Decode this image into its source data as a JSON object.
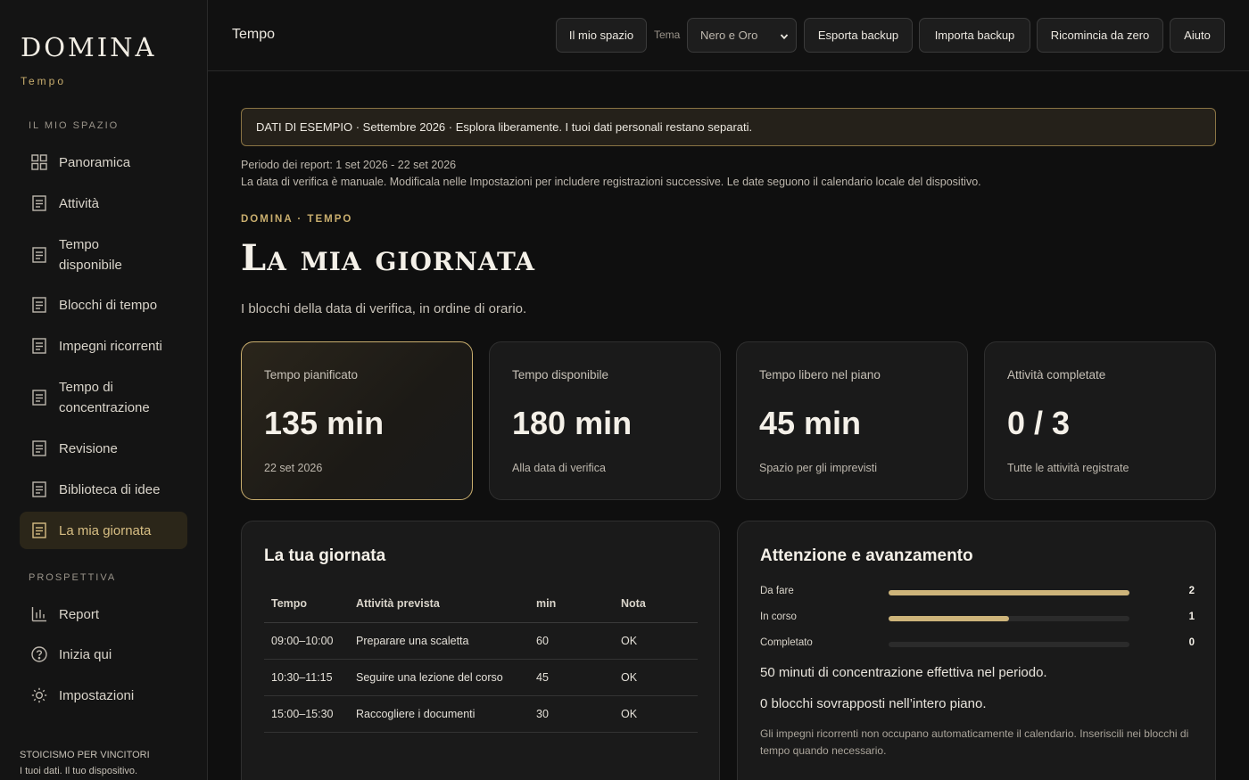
{
  "sidebar": {
    "brand": "DOMINA",
    "brand_sub": "Tempo",
    "section1": "IL MIO SPAZIO",
    "items": [
      {
        "label": "Panoramica",
        "icon": "grid-icon"
      },
      {
        "label": "Attività",
        "icon": "document-icon"
      },
      {
        "label": "Tempo disponibile",
        "icon": "document-icon"
      },
      {
        "label": "Blocchi di tempo",
        "icon": "document-icon"
      },
      {
        "label": "Impegni ricorrenti",
        "icon": "document-icon"
      },
      {
        "label": "Tempo di concentrazione",
        "icon": "document-icon"
      },
      {
        "label": "Revisione",
        "icon": "document-icon"
      },
      {
        "label": "Biblioteca di idee",
        "icon": "document-icon"
      },
      {
        "label": "La mia giornata",
        "icon": "document-icon",
        "active": true
      }
    ],
    "section2": "PROSPETTIVA",
    "items2": [
      {
        "label": "Report",
        "icon": "bar-chart-icon"
      },
      {
        "label": "Inizia qui",
        "icon": "help-circle-icon"
      },
      {
        "label": "Impostazioni",
        "icon": "sun-gear-icon"
      }
    ],
    "footer_line1": "STOICISMO PER VINCITORI",
    "footer_line2": "I tuoi dati. Il tuo dispositivo."
  },
  "topbar": {
    "title": "Tempo",
    "my_space": "Il mio spazio",
    "theme_label": "Tema",
    "theme_value": "Nero e Oro",
    "export": "Esporta backup",
    "import": "Importa backup",
    "reset": "Ricomincia da zero",
    "help": "Aiuto"
  },
  "banner": "DATI DI ESEMPIO · Settembre 2026 · Esplora liberamente. I tuoi dati personali restano separati.",
  "meta": {
    "period": "Periodo dei report: 1 set 2026 - 22 set 2026",
    "note": "La data di verifica è manuale. Modificala nelle Impostazioni per includere registrazioni successive. Le date seguono il calendario locale del dispositivo."
  },
  "page": {
    "eyebrow": "DOMINA · TEMPO",
    "title": "La mia giornata",
    "subtitle": "I blocchi della data di verifica, in ordine di orario."
  },
  "cards": [
    {
      "label": "Tempo pianificato",
      "value": "135 min",
      "note": "22 set 2026"
    },
    {
      "label": "Tempo disponibile",
      "value": "180 min",
      "note": "Alla data di verifica"
    },
    {
      "label": "Tempo libero nel piano",
      "value": "45 min",
      "note": "Spazio per gli imprevisti"
    },
    {
      "label": "Attività completate",
      "value": "0 / 3",
      "note": "Tutte le attività registrate"
    }
  ],
  "schedule": {
    "title": "La tua giornata",
    "headers": [
      "Tempo",
      "Attività prevista",
      "min",
      "Nota"
    ],
    "rows": [
      [
        "09:00–10:00",
        "Preparare una scaletta",
        "60",
        "OK"
      ],
      [
        "10:30–11:15",
        "Seguire una lezione del corso",
        "45",
        "OK"
      ],
      [
        "15:00–15:30",
        "Raccogliere i documenti",
        "30",
        "OK"
      ]
    ]
  },
  "progress": {
    "title": "Attenzione e avanzamento",
    "rows": [
      {
        "label": "Da fare",
        "value": "2",
        "fraction": 1.0
      },
      {
        "label": "In corso",
        "value": "1",
        "fraction": 0.5
      },
      {
        "label": "Completato",
        "value": "0",
        "fraction": 0.0
      }
    ],
    "line1": "50 minuti di concentrazione effettiva nel periodo.",
    "line2": "0 blocchi sovrapposti nell’intero piano.",
    "note": "Gli impegni ricorrenti non occupano automaticamente il calendario. Inseriscili nei blocchi di tempo quando necessario."
  },
  "colors": {
    "accent": "#c9ae6e",
    "background": "#0f0f0f",
    "panel": "#1a1a1a"
  }
}
